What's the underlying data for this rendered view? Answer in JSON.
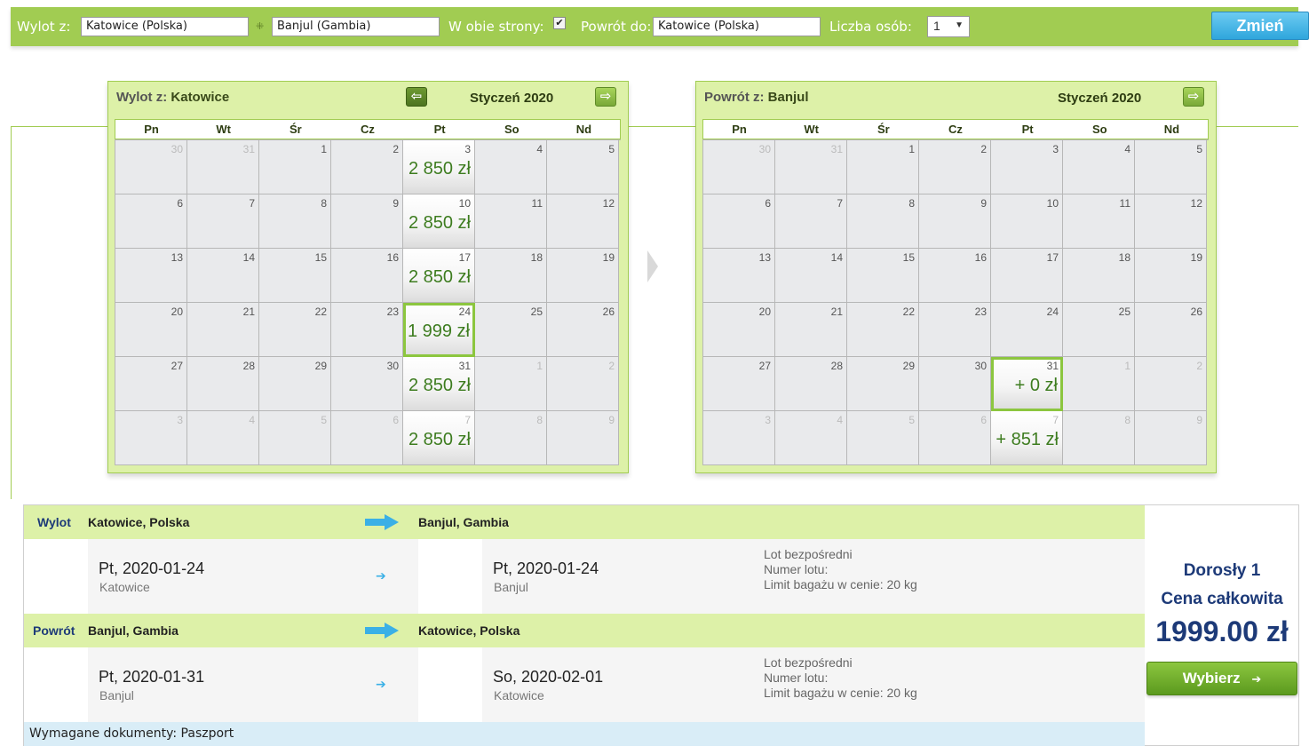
{
  "search": {
    "from_label": "Wylot z:",
    "from_value": "Katowice (Polska)",
    "to_value": "Banjul (Gambia)",
    "roundtrip_label": "W obie strony:",
    "roundtrip_checked": "✔",
    "return_label": "Powrót do:",
    "return_value": "Katowice (Polska)",
    "persons_label": "Liczba osób:",
    "persons_value": "1",
    "change_button": "Zmień"
  },
  "calendar_out": {
    "title_prefix": "Wylot z:",
    "title_city": "Katowice",
    "month": "Styczeń 2020",
    "days": [
      "Pn",
      "Wt",
      "Śr",
      "Cz",
      "Pt",
      "So",
      "Nd"
    ],
    "cells": [
      {
        "n": "30",
        "other": true
      },
      {
        "n": "31",
        "other": true
      },
      {
        "n": "1"
      },
      {
        "n": "2"
      },
      {
        "n": "3",
        "price": "2 850 zł"
      },
      {
        "n": "4"
      },
      {
        "n": "5"
      },
      {
        "n": "6"
      },
      {
        "n": "7"
      },
      {
        "n": "8"
      },
      {
        "n": "9"
      },
      {
        "n": "10",
        "price": "2 850 zł"
      },
      {
        "n": "11"
      },
      {
        "n": "12"
      },
      {
        "n": "13"
      },
      {
        "n": "14"
      },
      {
        "n": "15"
      },
      {
        "n": "16"
      },
      {
        "n": "17",
        "price": "2 850 zł"
      },
      {
        "n": "18"
      },
      {
        "n": "19"
      },
      {
        "n": "20"
      },
      {
        "n": "21"
      },
      {
        "n": "22"
      },
      {
        "n": "23"
      },
      {
        "n": "24",
        "price": "1 999 zł",
        "selected": true
      },
      {
        "n": "25"
      },
      {
        "n": "26"
      },
      {
        "n": "27"
      },
      {
        "n": "28"
      },
      {
        "n": "29"
      },
      {
        "n": "30"
      },
      {
        "n": "31",
        "price": "2 850 zł"
      },
      {
        "n": "1",
        "other": true
      },
      {
        "n": "2",
        "other": true
      },
      {
        "n": "3",
        "other": true
      },
      {
        "n": "4",
        "other": true
      },
      {
        "n": "5",
        "other": true
      },
      {
        "n": "6",
        "other": true
      },
      {
        "n": "7",
        "other": true,
        "price": "2 850 zł"
      },
      {
        "n": "8",
        "other": true
      },
      {
        "n": "9",
        "other": true
      }
    ]
  },
  "calendar_ret": {
    "title_prefix": "Powrót z:",
    "title_city": "Banjul",
    "month": "Styczeń 2020",
    "days": [
      "Pn",
      "Wt",
      "Śr",
      "Cz",
      "Pt",
      "So",
      "Nd"
    ],
    "cells": [
      {
        "n": "30",
        "other": true
      },
      {
        "n": "31",
        "other": true
      },
      {
        "n": "1"
      },
      {
        "n": "2"
      },
      {
        "n": "3"
      },
      {
        "n": "4"
      },
      {
        "n": "5"
      },
      {
        "n": "6"
      },
      {
        "n": "7"
      },
      {
        "n": "8"
      },
      {
        "n": "9"
      },
      {
        "n": "10"
      },
      {
        "n": "11"
      },
      {
        "n": "12"
      },
      {
        "n": "13"
      },
      {
        "n": "14"
      },
      {
        "n": "15"
      },
      {
        "n": "16"
      },
      {
        "n": "17"
      },
      {
        "n": "18"
      },
      {
        "n": "19"
      },
      {
        "n": "20"
      },
      {
        "n": "21"
      },
      {
        "n": "22"
      },
      {
        "n": "23"
      },
      {
        "n": "24"
      },
      {
        "n": "25"
      },
      {
        "n": "26"
      },
      {
        "n": "27"
      },
      {
        "n": "28"
      },
      {
        "n": "29"
      },
      {
        "n": "30"
      },
      {
        "n": "31",
        "price": "+ 0 zł",
        "selected": true
      },
      {
        "n": "1",
        "other": true
      },
      {
        "n": "2",
        "other": true
      },
      {
        "n": "3",
        "other": true
      },
      {
        "n": "4",
        "other": true
      },
      {
        "n": "5",
        "other": true
      },
      {
        "n": "6",
        "other": true
      },
      {
        "n": "7",
        "other": true,
        "price": "+ 851 zł"
      },
      {
        "n": "8",
        "other": true
      },
      {
        "n": "9",
        "other": true
      }
    ]
  },
  "outbound": {
    "kind": "Wylot",
    "from_city": "Katowice, Polska",
    "to_city": "Banjul, Gambia",
    "dep_date": "Pt, 2020-01-24",
    "dep_place": "Katowice",
    "arr_date": "Pt, 2020-01-24",
    "arr_place": "Banjul",
    "info": [
      "Lot bezpośredni",
      "Numer lotu:",
      "Limit bagażu w cenie: 20 kg"
    ]
  },
  "inbound": {
    "kind": "Powrót",
    "from_city": "Banjul, Gambia",
    "to_city": "Katowice, Polska",
    "dep_date": "Pt, 2020-01-31",
    "dep_place": "Banjul",
    "arr_date": "So, 2020-02-01",
    "arr_place": "Katowice",
    "info": [
      "Lot bezpośredni",
      "Numer lotu:",
      "Limit bagażu w cenie: 20 kg"
    ]
  },
  "documents": "Wymagane dokumenty: Paszport",
  "price": {
    "passengers": "Dorosły 1",
    "total_label": "Cena całkowita",
    "total": "1999.00 zł",
    "select_button": "Wybierz"
  },
  "colors": {
    "accent_green": "#a1cc52",
    "price_green": "#3d7c1f",
    "title_blue": "#1d3a78",
    "button_blue": "#2fa6dc"
  }
}
